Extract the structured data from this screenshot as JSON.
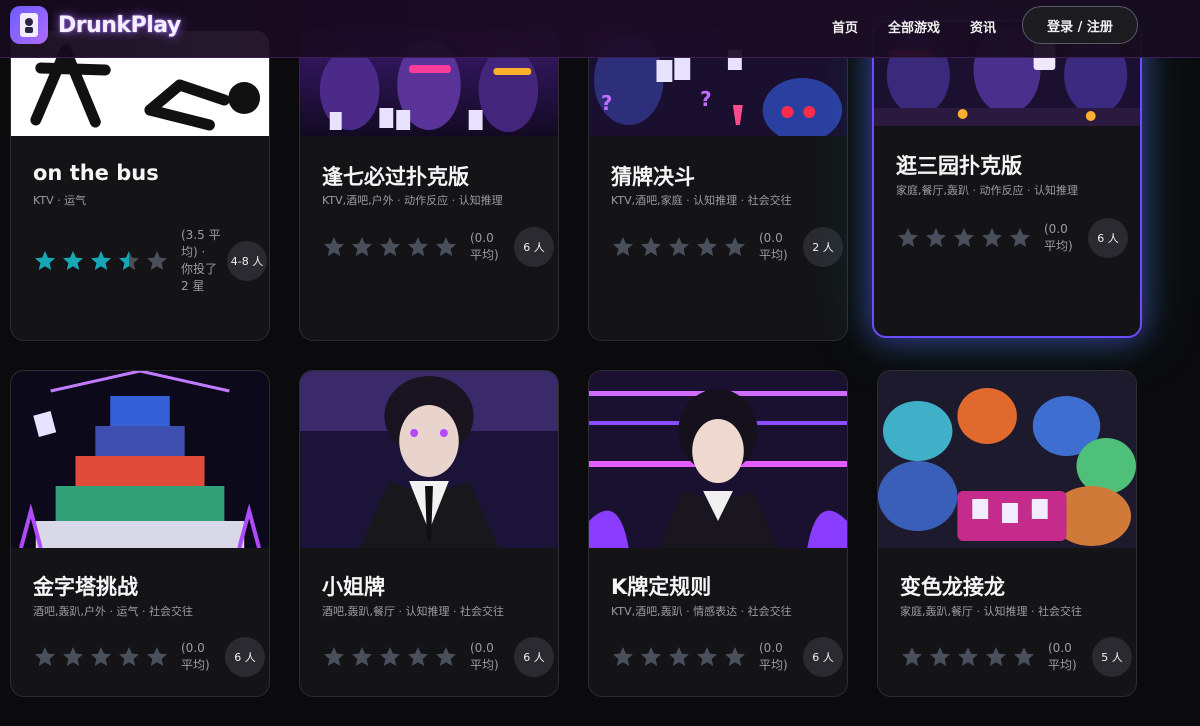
{
  "app": {
    "name": "DrunkPlay"
  },
  "nav": {
    "home": "首页",
    "all_games": "全部游戏",
    "news": "资讯",
    "login": "登录 / 注册"
  },
  "colors": {
    "accent": "#7a5cff",
    "star_filled": "#18a7b5",
    "star_empty": "#4a4f5c",
    "card_bg": "#141416"
  },
  "cards": [
    {
      "title": "on the bus",
      "tags": "KTV · 运气",
      "rating": 3.5,
      "avg_text": "(3.5 平均) · 你投了 2 星",
      "players": "4-8 人",
      "art": "stickman"
    },
    {
      "title": "逢七必过扑克版",
      "tags": "KTV,酒吧,户外 · 动作反应 · 认知推理",
      "rating": 0,
      "avg_text": "(0.0 平均)",
      "players": "6 人",
      "art": "demons-neon"
    },
    {
      "title": "猜牌决斗",
      "tags": "KTV,酒吧,家庭 · 认知推理 · 社会交往",
      "rating": 0,
      "avg_text": "(0.0 平均)",
      "players": "2 人",
      "art": "monsters-cards"
    },
    {
      "title": "逛三园扑克版",
      "tags": "家庭,餐厅,轰趴 · 动作反应 · 认知推理",
      "rating": 0,
      "avg_text": "(0.0 平均)",
      "players": "6 人",
      "art": "party-table"
    },
    {
      "title": "金字塔挑战",
      "tags": "酒吧,轰趴,户外 · 运气 · 社会交往",
      "rating": 0,
      "avg_text": "(0.0 平均)",
      "players": "6 人",
      "art": "card-pyramid"
    },
    {
      "title": "小姐牌",
      "tags": "酒吧,轰趴,餐厅 · 认知推理 · 社会交往",
      "rating": 0,
      "avg_text": "(0.0 平均)",
      "players": "6 人",
      "art": "anime-girl-suit"
    },
    {
      "title": "K牌定规则",
      "tags": "KTV,酒吧,轰趴 · 情感表达 · 社会交往",
      "rating": 0,
      "avg_text": "(0.0 平均)",
      "players": "6 人",
      "art": "anime-girl-bar"
    },
    {
      "title": "变色龙接龙",
      "tags": "家庭,轰趴,餐厅 · 认知推理 · 社会交往",
      "rating": 0,
      "avg_text": "(0.0 平均)",
      "players": "5 人",
      "art": "lizards-cards"
    }
  ]
}
